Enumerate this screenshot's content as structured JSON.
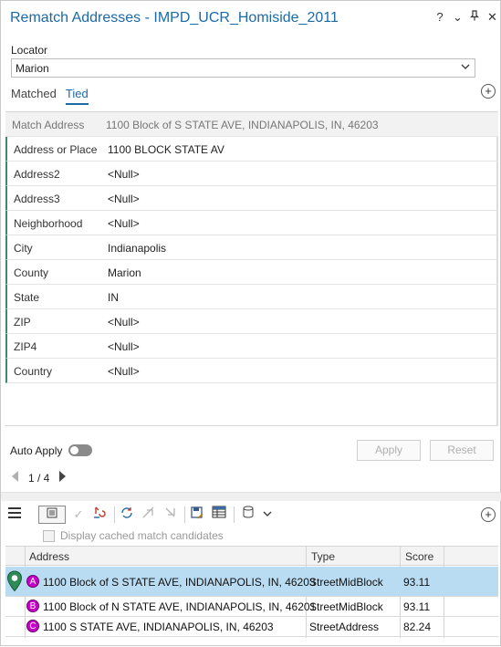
{
  "window": {
    "title": "Rematch Addresses - IMPD_UCR_Homiside_2011",
    "controls": [
      "?",
      "⌄",
      "⊥",
      "✕"
    ]
  },
  "locator": {
    "label": "Locator",
    "value": "Marion"
  },
  "tabs": [
    {
      "label": "Matched",
      "active": false
    },
    {
      "label": "Tied",
      "active": true
    }
  ],
  "fields": [
    {
      "label": "Match Address",
      "value": "1100 Block of S STATE AVE, INDIANAPOLIS, IN, 46203",
      "readonly": true
    },
    {
      "label": "Address or Place",
      "value": "1100 BLOCK STATE AV"
    },
    {
      "label": "Address2",
      "value": "<Null>"
    },
    {
      "label": "Address3",
      "value": "<Null>"
    },
    {
      "label": "Neighborhood",
      "value": "<Null>"
    },
    {
      "label": "City",
      "value": "Indianapolis"
    },
    {
      "label": "County",
      "value": "Marion"
    },
    {
      "label": "State",
      "value": "IN"
    },
    {
      "label": "ZIP",
      "value": "<Null>"
    },
    {
      "label": "ZIP4",
      "value": "<Null>"
    },
    {
      "label": "Country",
      "value": "<Null>"
    }
  ],
  "auto_apply": {
    "label": "Auto Apply",
    "on": false
  },
  "buttons": {
    "apply": "Apply",
    "reset": "Reset"
  },
  "pager": {
    "text": "1 / 4"
  },
  "cache": {
    "label": "Display cached match candidates",
    "checked": false
  },
  "candidates": {
    "headers": {
      "address": "Address",
      "type": "Type",
      "score": "Score"
    },
    "rows": [
      {
        "letter": "A",
        "address": "1100 Block of S STATE AVE, INDIANAPOLIS, IN, 46203",
        "type": "StreetMidBlock",
        "score": "93.11",
        "selected": true
      },
      {
        "letter": "B",
        "address": "1100 Block of N STATE AVE, INDIANAPOLIS, IN, 46201",
        "type": "StreetMidBlock",
        "score": "93.11",
        "selected": false
      },
      {
        "letter": "C",
        "address": "1100 S STATE AVE, INDIANAPOLIS, IN, 46203",
        "type": "StreetAddress",
        "score": "82.24",
        "selected": false
      }
    ]
  },
  "icons": {
    "menu": "hamburger-menu-icon",
    "add": "add-circle-icon",
    "candidate_marker": "magenta-letter-circle",
    "selected_pin": "green-location-pin-icon"
  },
  "colors": {
    "accent": "#1b6aa6",
    "selected_row": "#b9dcf2",
    "marker": "#c800c8",
    "pin": "#2e8b57"
  }
}
